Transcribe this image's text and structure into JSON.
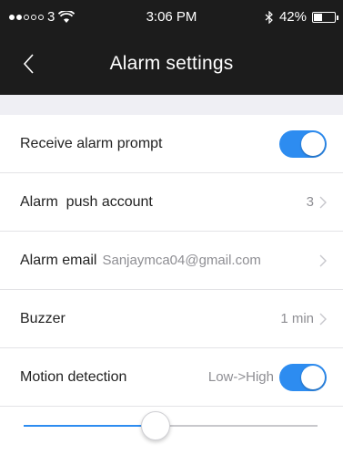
{
  "status_bar": {
    "carrier": "3",
    "time": "3:06 PM",
    "battery": "42%",
    "battery_level": 0.42,
    "icons": [
      "signal-dots-icon",
      "wifi-icon",
      "bluetooth-icon",
      "battery-icon"
    ]
  },
  "nav": {
    "title": "Alarm settings",
    "back_icon": "chevron-left-icon"
  },
  "rows": {
    "receive_alarm": {
      "label": "Receive alarm prompt",
      "toggle_on": true
    },
    "push_account": {
      "label": "Alarm  push account",
      "value": "3"
    },
    "alarm_email": {
      "label": "Alarm email",
      "value": "Sanjaymca04@gmail.com"
    },
    "buzzer": {
      "label": "Buzzer",
      "value": "1 min"
    },
    "motion": {
      "label": "Motion detection",
      "value": "Low->High",
      "toggle_on": true
    }
  },
  "sensitivity_slider": {
    "level": 0.45
  },
  "colors": {
    "accent": "#2d8cf0",
    "bar": "#1c1c1c",
    "section_bg": "#efeff4"
  }
}
